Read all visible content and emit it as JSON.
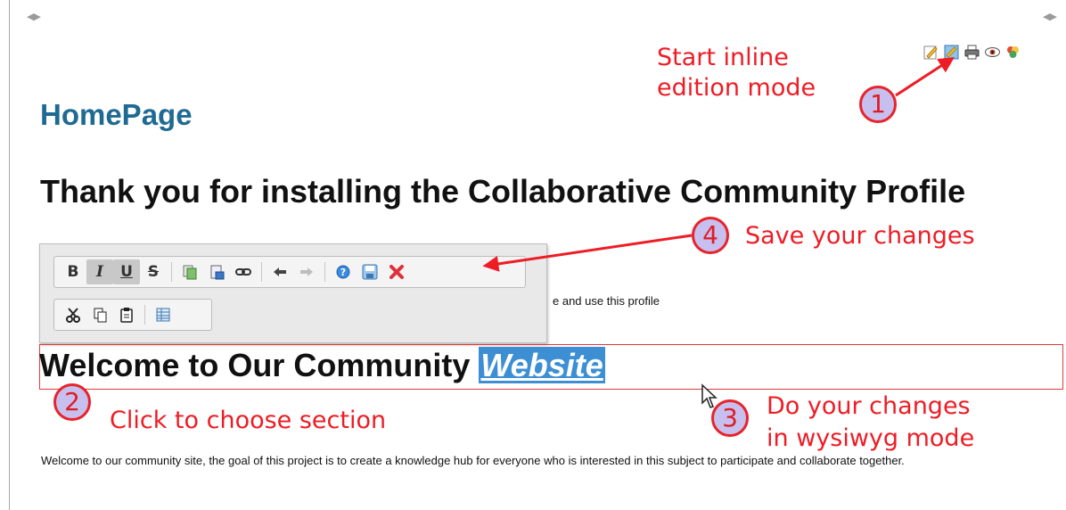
{
  "page": {
    "title": "HomePage",
    "heading": "Thank you for installing the Collaborative Community Profile",
    "partial_text": "e and use this profile",
    "section_heading_prefix": "Welcome to Our Community",
    "section_heading_selected": "Website",
    "body_text": "Welcome to our community site, the goal of this project is to create a knowledge hub for everyone who is interested in this subject to participate and collaborate together."
  },
  "collapse_controls": {
    "left": "◀▶",
    "right": "◀▶"
  },
  "page_icons": [
    "edit-icon",
    "inline-edit-icon",
    "print-icon",
    "watch-icon",
    "colors-icon"
  ],
  "toolbar": {
    "row1": [
      "B",
      "I",
      "U",
      "S",
      "copy",
      "paste",
      "link",
      "undo",
      "redo",
      "help",
      "save",
      "cancel"
    ],
    "row2": [
      "cut",
      "copy",
      "paste",
      "table"
    ]
  },
  "annotations": {
    "step1": {
      "number": "1",
      "text": "Start inline\nedition mode"
    },
    "step2": {
      "number": "2",
      "text": "Click to choose section"
    },
    "step3": {
      "number": "3",
      "text": "Do your changes\nin wysiwyg mode"
    },
    "step4": {
      "number": "4",
      "text": "Save your changes"
    }
  },
  "colors": {
    "annotation": "#ee1c25",
    "title": "#1f6a93",
    "selection": "#3d8fd4"
  }
}
